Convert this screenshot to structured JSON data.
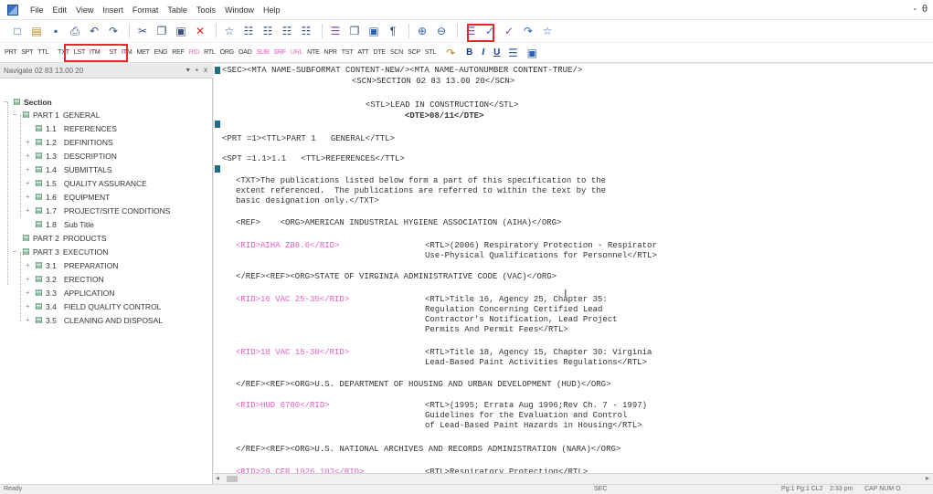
{
  "menu": [
    "File",
    "Edit",
    "View",
    "Insert",
    "Format",
    "Table",
    "Tools",
    "Window",
    "Help"
  ],
  "window_ctrl": "- ",
  "window_ctrl_b": "θ",
  "toolbar1_icons": {
    "new": "□",
    "open": "▤",
    "save": "▪",
    "print": "⎙",
    "undo": "↶",
    "redo": "↷",
    "cut": "✂",
    "copy": "❐",
    "paste": "▣",
    "delete": "✕",
    "find": "☆",
    "bindoc": "☷",
    "zoom_in": "⊕",
    "zoom_out": "⊖",
    "list": "☰",
    "spell": "✓",
    "pilcrow": "¶"
  },
  "tags": [
    "PRT",
    "SPT",
    "TTL",
    "TXT",
    "LST",
    "ITM",
    "ST",
    "ITM",
    "MET",
    "ENG",
    "REF",
    "RID",
    "RTL",
    "ORG",
    "OAD",
    "SUB",
    "SRF",
    "URL",
    "NTE",
    "NPR",
    "TST",
    "ATT",
    "DTE",
    "SCN",
    "SCP",
    "STL"
  ],
  "format_buttons": {
    "bold": "B",
    "italic": "I",
    "underline": "U"
  },
  "navigator": {
    "title": "Navigate 02 83 13.00 20",
    "controls": "▾ ▪ x",
    "root": "Section",
    "items": [
      {
        "num": "PART 1",
        "label": "GENERAL"
      },
      {
        "num": "1.1",
        "label": "REFERENCES"
      },
      {
        "num": "1.2",
        "label": "DEFINITIONS"
      },
      {
        "num": "1.3",
        "label": "DESCRIPTION"
      },
      {
        "num": "1.4",
        "label": "SUBMITTALS"
      },
      {
        "num": "1.5",
        "label": "QUALITY ASSURANCE"
      },
      {
        "num": "1.6",
        "label": "EQUIPMENT"
      },
      {
        "num": "1.7",
        "label": "PROJECT/SITE CONDITIONS"
      },
      {
        "num": "1.8",
        "label": "Sub Title"
      },
      {
        "num": "PART 2",
        "label": "PRODUCTS"
      },
      {
        "num": "PART 3",
        "label": "EXECUTION"
      },
      {
        "num": "3.1",
        "label": "PREPARATION"
      },
      {
        "num": "3.2",
        "label": "ERECTION"
      },
      {
        "num": "3.3",
        "label": "APPLICATION"
      },
      {
        "num": "3.4",
        "label": "FIELD QUALITY CONTROL"
      },
      {
        "num": "3.5",
        "label": "CLEANING AND DISPOSAL"
      }
    ]
  },
  "editor": {
    "l1": "<SEC><MTA NAME-SUBFORMAT CONTENT-NEW/><MTA NAME-AUTONUMBER CONTENT-TRUE/>",
    "l2": "<SCN>SECTION 02 83 13.00 20</SCN>",
    "l3": "<STL>LEAD IN CONSTRUCTION</STL>",
    "l4": "<DTE>08/11</DTE>",
    "l5": "<PRT =1><TTL>PART 1   GENERAL</TTL>",
    "l6": "<SPT =1.1>1.1   <TTL>REFERENCES</TTL>",
    "l7": "<TXT>The publications listed below form a part of this specification to the",
    "l8": "extent referenced.  The publications are referred to within the text by the",
    "l9": "basic designation only.</TXT>",
    "l10": "<REF>    <ORG>AMERICAN INDUSTRIAL HYGIENE ASSOCIATION (AIHA)</ORG>",
    "rid1": "<RID>AIHA Z88.6</RID>",
    "rtl1a": "<RTL>(2006) Respiratory Protection - Respirator",
    "rtl1b": "Use-Physical Qualifications for Personnel</RTL>",
    "l11": "</REF><REF><ORG>STATE OF VIRGINIA ADMINISTRATIVE CODE (VAC)</ORG>",
    "rid2": "<RID>16 VAC 25-35</RID>",
    "rtl2a": "<RTL>Title 16, Agency 25, Chapter 35:",
    "rtl2b": "Regulation Concerning Certified Lead",
    "rtl2c": "Contractor's Notification, Lead Project",
    "rtl2d": "Permits And Permit Fees</RTL>",
    "rid3": "<RID>18 VAC 15-30</RID>",
    "rtl3a": "<RTL>Title 18, Agency 15, Chapter 30: Virginia",
    "rtl3b": "Lead-Based Paint Activities Regulations</RTL>",
    "l12": "</REF><REF><ORG>U.S. DEPARTMENT OF HOUSING AND URBAN DEVELOPMENT (HUD)</ORG>",
    "rid4": "<RID>HUD 6780</RID>",
    "rtl4a": "<RTL>(1995; Errata Aug 1996;Rev Ch. 7 - 1997)",
    "rtl4b": "Guidelines for the Evaluation and Control",
    "rtl4c": "of Lead-Based Paint Hazards in Housing</RTL>",
    "l13": "</REF><REF><ORG>U.S. NATIONAL ARCHIVES AND RECORDS ADMINISTRATION (NARA)</ORG>",
    "rid5": "<RID>29 CFR 1926.103</RID>",
    "rtl5a": "<RTL>Respiratory Protection</RTL>"
  },
  "statusbar": {
    "left": "Ready",
    "mode": "SEC",
    "position": "Pg:1 Pg:1 CL2",
    "time": "2:33 pm",
    "keys": "CAP NUM O"
  },
  "colors": {
    "highlight": "#e32b2b",
    "tag_pink": "#e060c4",
    "marker": "#1d6e86"
  }
}
